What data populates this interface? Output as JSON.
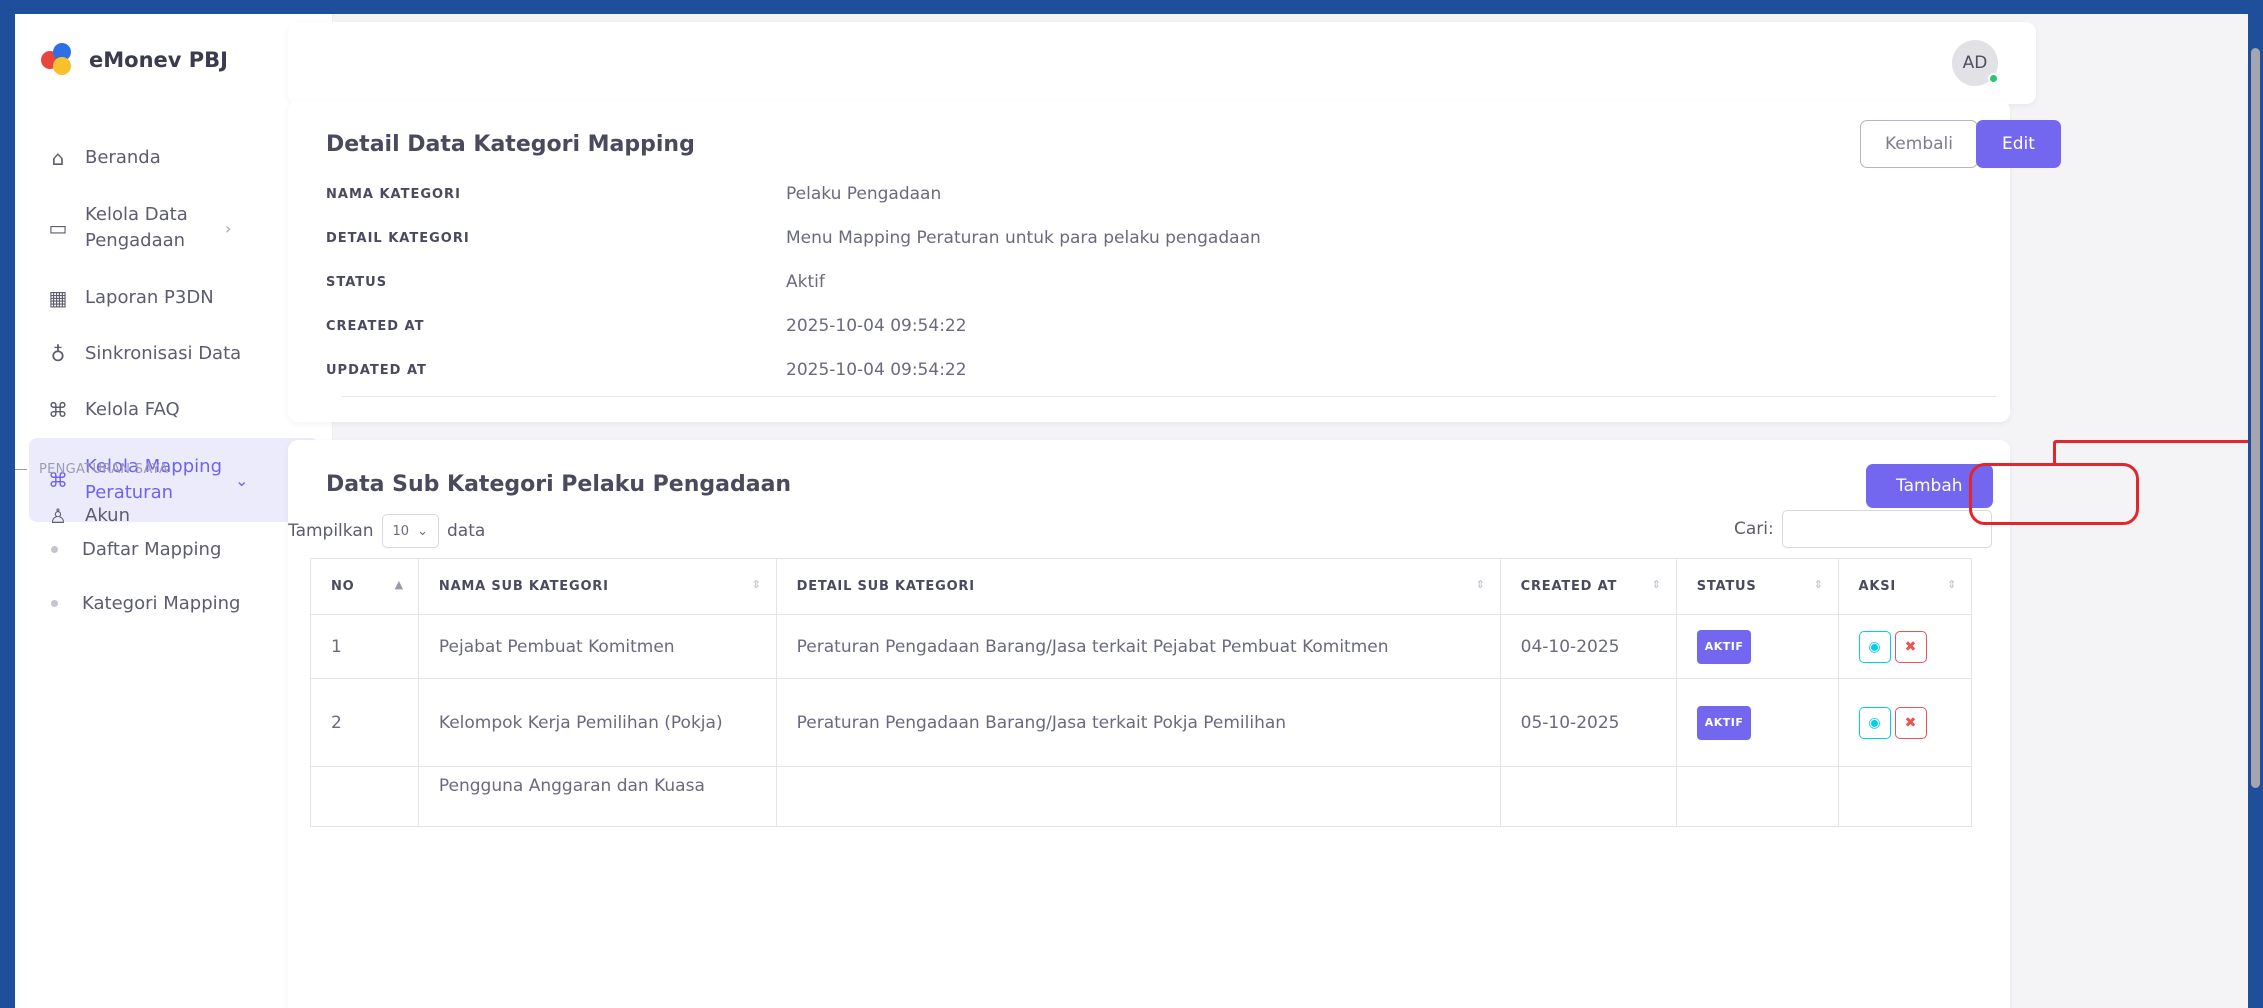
{
  "brand": {
    "name": "eMonev PBJ"
  },
  "sidebar": {
    "items": [
      {
        "label": "Beranda",
        "icon": "home-icon",
        "glyph": "⌂"
      },
      {
        "label": "Kelola Data Pengadaan",
        "icon": "folder-icon",
        "glyph": "▭",
        "chevron": "›"
      },
      {
        "label": "Laporan P3DN",
        "icon": "report-icon",
        "glyph": "▦",
        "chevron": "›"
      },
      {
        "label": "Sinkronisasi Data",
        "icon": "sync-icon",
        "glyph": "♁"
      },
      {
        "label": "Kelola FAQ",
        "icon": "command-icon",
        "glyph": "⌘",
        "chevron": "›"
      },
      {
        "label": "Kelola Mapping Peraturan",
        "icon": "command-icon",
        "glyph": "⌘",
        "chevron": "⌄"
      }
    ],
    "sub_items": [
      "Daftar Mapping",
      "Kategori Mapping"
    ],
    "section_label": "PENGATURAN SAYA",
    "akun": {
      "label": "Akun",
      "icon": "user-icon",
      "glyph": "♙",
      "chevron": "›"
    }
  },
  "header": {
    "avatar_initials": "AD"
  },
  "detail": {
    "title": "Detail Data Kategori Mapping",
    "back_label": "Kembali",
    "edit_label": "Edit",
    "rows": [
      {
        "key": "NAMA KATEGORI",
        "value": "Pelaku Pengadaan"
      },
      {
        "key": "DETAIL KATEGORI",
        "value": "Menu Mapping Peraturan untuk para pelaku pengadaan"
      },
      {
        "key": "STATUS",
        "value": "Aktif"
      },
      {
        "key": "CREATED AT",
        "value": "2025-10-04 09:54:22"
      },
      {
        "key": "UPDATED AT",
        "value": "2025-10-04 09:54:22"
      }
    ]
  },
  "sub": {
    "title": "Data Sub Kategori Pelaku Pengadaan",
    "add_label": "Tambah",
    "show_label": "Tampilkan",
    "page_length": "10",
    "data_label": "data",
    "search_label": "Cari:",
    "search_value": "",
    "columns": [
      "NO",
      "NAMA SUB KATEGORI",
      "DETAIL SUB KATEGORI",
      "CREATED AT",
      "STATUS",
      "AKSI"
    ],
    "rows": [
      {
        "no": "1",
        "name": "Pejabat Pembuat Komitmen",
        "detail": "Peraturan Pengadaan Barang/Jasa terkait Pejabat Pembuat Komitmen",
        "created": "04-10-2025",
        "status": "AKTIF"
      },
      {
        "no": "2",
        "name": "Kelompok Kerja Pemilihan (Pokja)",
        "detail": "Peraturan Pengadaan Barang/Jasa terkait Pokja Pemilihan",
        "created": "05-10-2025",
        "status": "AKTIF"
      },
      {
        "no": "",
        "name": "Pengguna Anggaran dan Kuasa",
        "detail": "",
        "created": "",
        "status": ""
      }
    ]
  },
  "colors": {
    "primary": "#7367f0",
    "highlight": "#e3262b",
    "frame": "#1f4f9b"
  }
}
